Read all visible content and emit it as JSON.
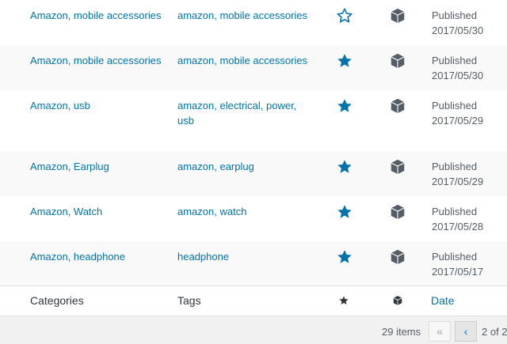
{
  "rows": [
    {
      "category": "Amazon, mobile accessories",
      "tags": "amazon, mobile accessories",
      "featured": false,
      "status": "Published",
      "date": "2017/05/30"
    },
    {
      "category": "Amazon, mobile accessories",
      "tags": "amazon, mobile accessories",
      "featured": true,
      "status": "Published",
      "date": "2017/05/30"
    },
    {
      "category": "Amazon, usb",
      "tags": "amazon, electrical, power, usb",
      "featured": true,
      "status": "Published",
      "date": "2017/05/29"
    },
    {
      "category": "Amazon, Earplug",
      "tags": "amazon, earplug",
      "featured": true,
      "status": "Published",
      "date": "2017/05/29"
    },
    {
      "category": "Amazon, Watch",
      "tags": "amazon, watch",
      "featured": true,
      "status": "Published",
      "date": "2017/05/28"
    },
    {
      "category": "Amazon, headphone",
      "tags": "headphone",
      "featured": true,
      "status": "Published",
      "date": "2017/05/17"
    }
  ],
  "footer": {
    "categories": "Categories",
    "tags": "Tags",
    "date": "Date"
  },
  "pagination": {
    "count": "29 items",
    "first": "«",
    "prev": "‹",
    "page_text": "2 of 2"
  },
  "colors": {
    "link": "#0073aa",
    "star": "#0073aa",
    "box": "#555d66"
  },
  "icons": {
    "featured": "star-filled-icon",
    "not_featured": "star-outline-icon",
    "type": "product-box-icon"
  }
}
